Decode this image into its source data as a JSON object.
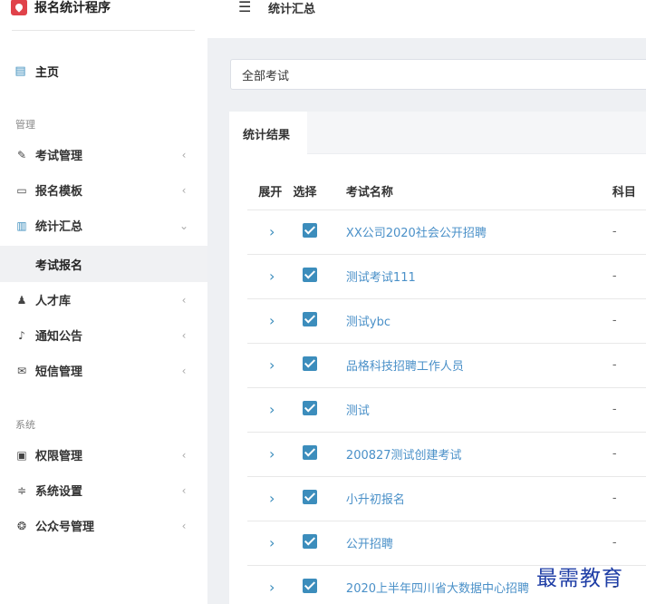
{
  "app": {
    "title": "报名统计程序"
  },
  "header": {
    "menu_icon": "☰",
    "title": "统计汇总"
  },
  "sidebar": {
    "home": {
      "label": "主页",
      "icon": "clipboard-icon"
    },
    "sections": [
      {
        "label": "管理"
      },
      {
        "label": "系统"
      }
    ],
    "items": [
      {
        "label": "考试管理",
        "icon": "edit-icon"
      },
      {
        "label": "报名模板",
        "icon": "id-card-icon"
      },
      {
        "label": "统计汇总",
        "icon": "bar-chart-icon"
      },
      {
        "label": "人才库",
        "icon": "users-icon"
      },
      {
        "label": "通知公告",
        "icon": "bell-icon"
      },
      {
        "label": "短信管理",
        "icon": "envelope-icon"
      },
      {
        "label": "权限管理",
        "icon": "lock-icon"
      },
      {
        "label": "系统设置",
        "icon": "sliders-icon"
      },
      {
        "label": "公众号管理",
        "icon": "wechat-icon"
      }
    ],
    "sub_item": {
      "label": "考试报名"
    }
  },
  "filter": {
    "value": "全部考试"
  },
  "panel": {
    "tab_label": "统计结果"
  },
  "table": {
    "headers": {
      "expand": "展开",
      "select": "选择",
      "name": "考试名称",
      "subject": "科目"
    },
    "rows": [
      {
        "name": "XX公司2020社会公开招聘",
        "subject": "-"
      },
      {
        "name": "测试考试111",
        "subject": "-"
      },
      {
        "name": "测试ybc",
        "subject": "-"
      },
      {
        "name": "品格科技招聘工作人员",
        "subject": "-"
      },
      {
        "name": "测试",
        "subject": "-"
      },
      {
        "name": "200827测试创建考试",
        "subject": "-"
      },
      {
        "name": "小升初报名",
        "subject": "-"
      },
      {
        "name": "公开招聘",
        "subject": "-"
      },
      {
        "name": "2020上半年四川省大数据中心招聘",
        "subject": "-"
      }
    ]
  },
  "watermark": {
    "text": "最需教育"
  },
  "colors": {
    "accent": "#3c8dbc",
    "link": "#4a90c8",
    "content_bg": "#eef0f3",
    "brand": "#e0424a"
  }
}
